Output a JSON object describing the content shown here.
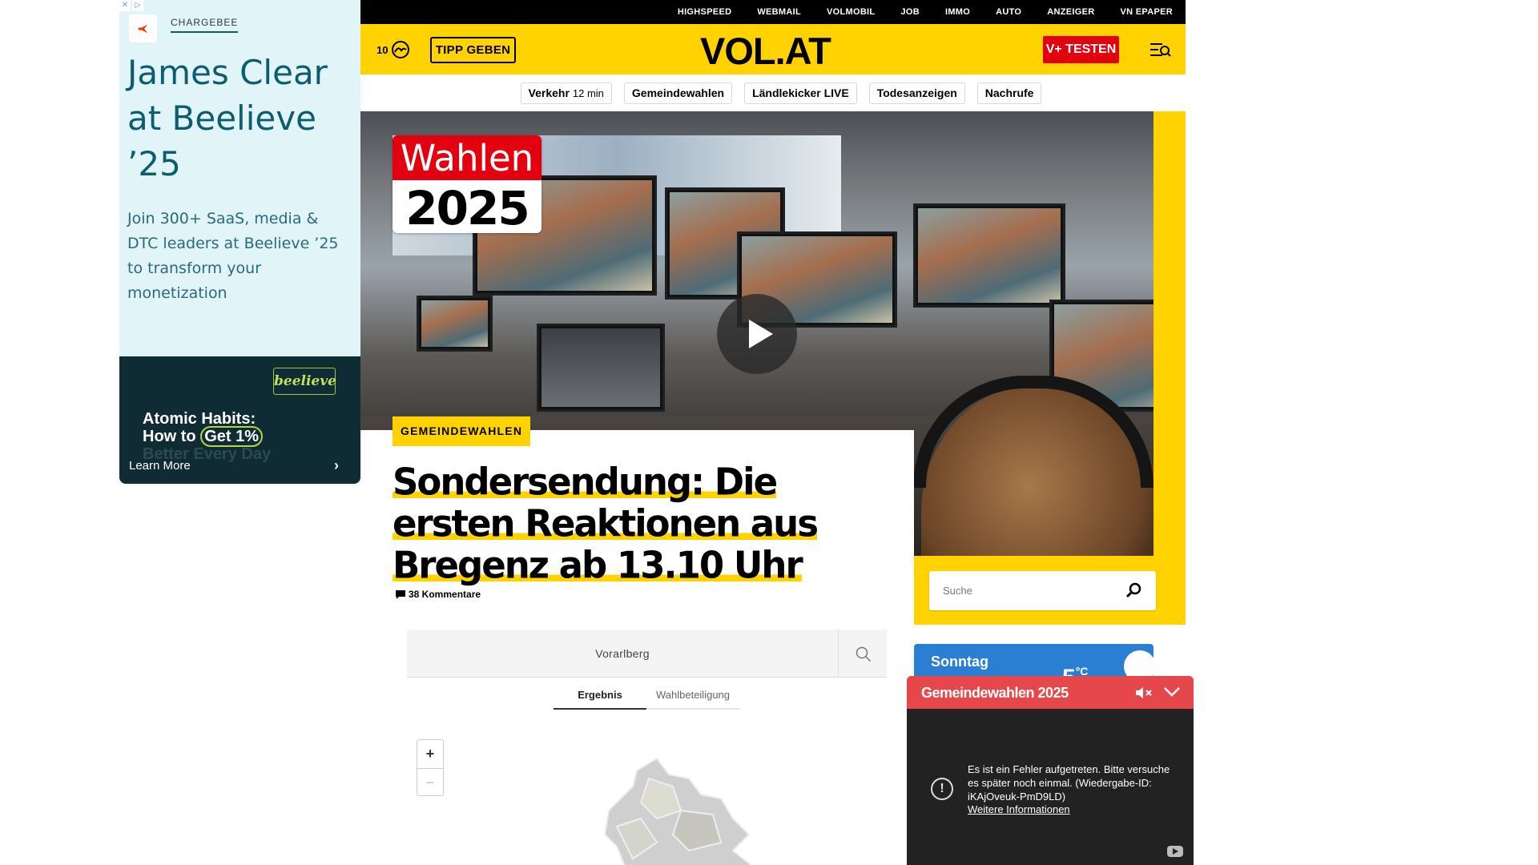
{
  "ad": {
    "close_x": "✕",
    "close_info": "▷",
    "brand": "CHARGEBEE",
    "headline": "James Clear at Beelieve ’25",
    "body": "Join 300+ SaaS, media & DTC leaders at Beelieve ’25 to transform your monetization",
    "badge": "beelieve",
    "book_line1": "Atomic Habits:",
    "book_line2_a": "How to ",
    "book_line2_b": "Get 1%",
    "book_line3": "Better Every Day",
    "cta": "Learn More",
    "cta_icon": "chevron-right-icon"
  },
  "topnav": [
    "HIGHSPEED",
    "WEBMAIL",
    "VOLMOBIL",
    "JOB",
    "IMMO",
    "AUTO",
    "ANZEIGER",
    "VN EPAPER"
  ],
  "header": {
    "count": "10",
    "tipp_label": "TIPP GEBEN",
    "logo": "VOL.AT",
    "vplus_label": "V+ TESTEN",
    "menu_icon": "menu-search-icon",
    "accent": "#ffd200",
    "red": "#e3000f"
  },
  "quicknav": {
    "traffic_label": "Verkehr",
    "traffic_value": "12 min",
    "items": [
      "Gemeindewahlen",
      "Ländlekicker LIVE",
      "Todesanzeigen",
      "Nachrufe"
    ]
  },
  "hero": {
    "badge_top": "Wahlen",
    "badge_year": "2025",
    "play_icon": "play-icon"
  },
  "article": {
    "kicker": "GEMEINDEWAHLEN",
    "headline": "Sondersendung: Die ersten Reaktionen aus Bregenz ab 13.10 Uhr",
    "comments": "38 Kommentare"
  },
  "election": {
    "region": "Vorarlberg",
    "tabs": [
      "Ergebnis",
      "Wahlbeteiligung"
    ],
    "zoom_in": "+",
    "zoom_out": "−"
  },
  "search": {
    "placeholder": "Suche"
  },
  "weather": {
    "day": "Sonntag",
    "temp": "5",
    "unit": "°C"
  },
  "player": {
    "title": "Gemeindewahlen 2025",
    "error_text": "Es ist ein Fehler aufgetreten. Bitte versuche es später noch einmal. (Wiedergabe-ID: iKAjOveuk-PmD9LD)",
    "error_link": "Weitere Informationen",
    "bar_color": "#e6474a"
  }
}
